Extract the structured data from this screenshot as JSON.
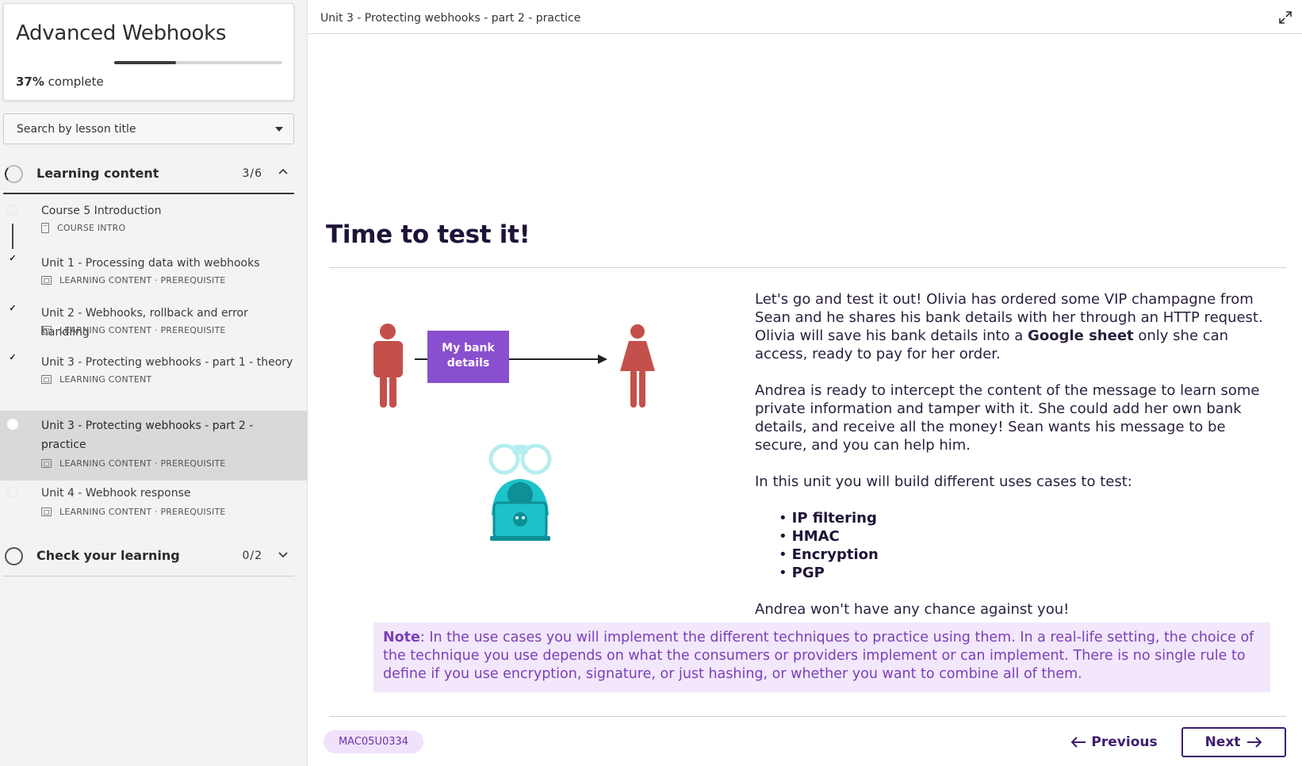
{
  "sidebar": {
    "course_title": "Advanced Webhooks",
    "progress_percent": "37%",
    "progress_suffix": " complete",
    "progress_fraction": 0.37,
    "search_placeholder": "Search by lesson title",
    "sections": [
      {
        "label": "Learning content",
        "count": "3/6",
        "expanded": true
      },
      {
        "label": "Check your learning",
        "count": "0/2",
        "expanded": false
      }
    ],
    "lessons": [
      {
        "title": "Course 5 Introduction",
        "type": "COURSE INTRO",
        "status": "not-started",
        "icon": "document-icon"
      },
      {
        "title": "Unit 1 - Processing data with webhooks",
        "type": "LEARNING CONTENT · PREREQUISITE",
        "status": "completed",
        "icon": "slides-icon"
      },
      {
        "title": "Unit 2 - Webhooks, rollback and error handling",
        "type": "LEARNING CONTENT · PREREQUISITE",
        "status": "completed",
        "icon": "slides-icon"
      },
      {
        "title": "Unit 3 - Protecting webhooks - part 1 - theory",
        "type": "LEARNING CONTENT",
        "status": "completed",
        "icon": "slides-icon"
      },
      {
        "title": "Unit 3 - Protecting webhooks - part 2 - practice",
        "type": "LEARNING CONTENT · PREREQUISITE",
        "status": "current",
        "icon": "slides-icon"
      },
      {
        "title": "Unit 4 - Webhook response",
        "type": "LEARNING CONTENT · PREREQUISITE",
        "status": "not-started",
        "icon": "slides-icon"
      }
    ]
  },
  "topbar": {
    "breadcrumb": "Unit 3 - Protecting webhooks - part 2 - practice"
  },
  "main": {
    "heading": "Time to test it!",
    "illustration": {
      "box_line1": "My bank",
      "box_line2": "details"
    },
    "para1_a": "Let's go and test it out! Olivia has ordered some VIP champagne from Sean and he shares his bank details with her through an HTTP request. Olivia will save his bank details into a ",
    "para1_bold": "Google sheet",
    "para1_b": " only she can access, ready to pay for her order.",
    "para2": "Andrea is ready to intercept the content of the message to learn some private information and tamper with it. She could add her own bank details, and receive all the money! Sean wants his message to be secure, and you can help him.",
    "para3": "In this unit you will build different uses cases to test:",
    "bullets": [
      "IP filtering",
      "HMAC",
      "Encryption",
      "PGP"
    ],
    "para4": "Andrea won't have any chance against you!",
    "note_label": "Note",
    "note_text": ": In the use cases you will implement the different techniques to practice using them. In a real-life setting, the choice of the technique you use depends on what the consumers or providers implement or can implement. There is no single rule to define if you use encryption, signature, or just hashing, or whether you want to combine all of them."
  },
  "footer": {
    "lesson_code": "MAC05U0334",
    "prev_label": "Previous",
    "next_label": "Next"
  },
  "colors": {
    "accent": "#3d1e6d",
    "note_bg": "#f2e7fb",
    "note_text": "#7a3fb8",
    "box_purple": "#8a4fcf",
    "person_red": "#c4504b",
    "hacker_teal": "#1cc3c9"
  }
}
